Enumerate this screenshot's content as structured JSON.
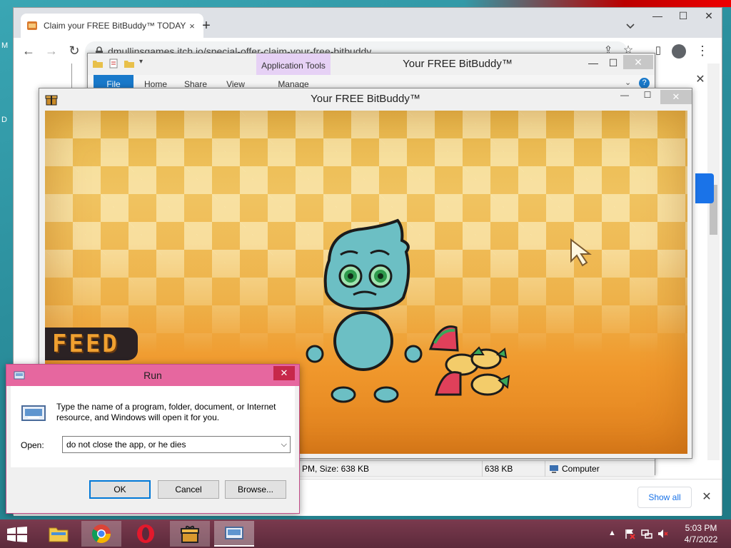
{
  "chrome": {
    "tab_title": "Claim your FREE BitBuddy™ TODAY",
    "tab_close": "×",
    "new_tab": "+",
    "url": "dmullinsgames.itch.io/special-offer-claim-your-free-bitbuddy",
    "min": "—",
    "max": "☐",
    "close": "✕",
    "popup_close": "✕",
    "download_bar": {
      "show_all": "Show all",
      "close": "✕"
    }
  },
  "explorer": {
    "contextual_tab": "Application Tools",
    "title": "Your FREE BitBuddy™",
    "ribbon_tabs": [
      "File",
      "Home",
      "Share",
      "View",
      "Manage"
    ],
    "status": {
      "left": "PM, Size: 638 KB",
      "size": "638 KB",
      "location": "Computer"
    }
  },
  "bitbuddy": {
    "title": "Your FREE BitBuddy™",
    "close": "✕",
    "min": "—",
    "max": "☐",
    "feed_label": "FEED",
    "colors": {
      "buddy": "#6cbfc4",
      "outline": "#1b1b1b",
      "eye": "#3aa85a",
      "watermelon": "#e0405a",
      "corn": "#f3cc6a"
    }
  },
  "run": {
    "title": "Run",
    "close": "✕",
    "description": "Type the name of a program, folder, document, or Internet resource, and Windows will open it for you.",
    "open_label": "Open:",
    "open_value": "do not close the app, or he dies",
    "ok": "OK",
    "cancel": "Cancel",
    "browse": "Browse..."
  },
  "taskbar": {
    "items": [
      "start-button",
      "file-explorer",
      "chrome",
      "opera",
      "bitbuddy",
      "run"
    ],
    "time": "5:03 PM",
    "date": "4/7/2022",
    "tray_chevron": "▲"
  },
  "desktop": {
    "left_edge_letters": [
      "M",
      "D"
    ]
  }
}
